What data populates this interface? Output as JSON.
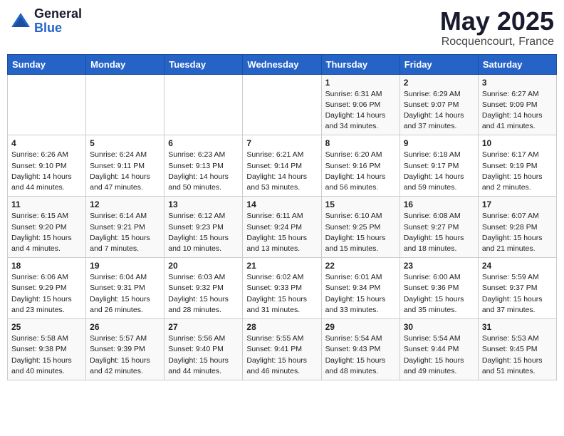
{
  "header": {
    "logo_general": "General",
    "logo_blue": "Blue",
    "month_title": "May 2025",
    "location": "Rocquencourt, France"
  },
  "weekdays": [
    "Sunday",
    "Monday",
    "Tuesday",
    "Wednesday",
    "Thursday",
    "Friday",
    "Saturday"
  ],
  "weeks": [
    [
      {
        "day": "",
        "info": ""
      },
      {
        "day": "",
        "info": ""
      },
      {
        "day": "",
        "info": ""
      },
      {
        "day": "",
        "info": ""
      },
      {
        "day": "1",
        "info": "Sunrise: 6:31 AM\nSunset: 9:06 PM\nDaylight: 14 hours\nand 34 minutes."
      },
      {
        "day": "2",
        "info": "Sunrise: 6:29 AM\nSunset: 9:07 PM\nDaylight: 14 hours\nand 37 minutes."
      },
      {
        "day": "3",
        "info": "Sunrise: 6:27 AM\nSunset: 9:09 PM\nDaylight: 14 hours\nand 41 minutes."
      }
    ],
    [
      {
        "day": "4",
        "info": "Sunrise: 6:26 AM\nSunset: 9:10 PM\nDaylight: 14 hours\nand 44 minutes."
      },
      {
        "day": "5",
        "info": "Sunrise: 6:24 AM\nSunset: 9:11 PM\nDaylight: 14 hours\nand 47 minutes."
      },
      {
        "day": "6",
        "info": "Sunrise: 6:23 AM\nSunset: 9:13 PM\nDaylight: 14 hours\nand 50 minutes."
      },
      {
        "day": "7",
        "info": "Sunrise: 6:21 AM\nSunset: 9:14 PM\nDaylight: 14 hours\nand 53 minutes."
      },
      {
        "day": "8",
        "info": "Sunrise: 6:20 AM\nSunset: 9:16 PM\nDaylight: 14 hours\nand 56 minutes."
      },
      {
        "day": "9",
        "info": "Sunrise: 6:18 AM\nSunset: 9:17 PM\nDaylight: 14 hours\nand 59 minutes."
      },
      {
        "day": "10",
        "info": "Sunrise: 6:17 AM\nSunset: 9:19 PM\nDaylight: 15 hours\nand 2 minutes."
      }
    ],
    [
      {
        "day": "11",
        "info": "Sunrise: 6:15 AM\nSunset: 9:20 PM\nDaylight: 15 hours\nand 4 minutes."
      },
      {
        "day": "12",
        "info": "Sunrise: 6:14 AM\nSunset: 9:21 PM\nDaylight: 15 hours\nand 7 minutes."
      },
      {
        "day": "13",
        "info": "Sunrise: 6:12 AM\nSunset: 9:23 PM\nDaylight: 15 hours\nand 10 minutes."
      },
      {
        "day": "14",
        "info": "Sunrise: 6:11 AM\nSunset: 9:24 PM\nDaylight: 15 hours\nand 13 minutes."
      },
      {
        "day": "15",
        "info": "Sunrise: 6:10 AM\nSunset: 9:25 PM\nDaylight: 15 hours\nand 15 minutes."
      },
      {
        "day": "16",
        "info": "Sunrise: 6:08 AM\nSunset: 9:27 PM\nDaylight: 15 hours\nand 18 minutes."
      },
      {
        "day": "17",
        "info": "Sunrise: 6:07 AM\nSunset: 9:28 PM\nDaylight: 15 hours\nand 21 minutes."
      }
    ],
    [
      {
        "day": "18",
        "info": "Sunrise: 6:06 AM\nSunset: 9:29 PM\nDaylight: 15 hours\nand 23 minutes."
      },
      {
        "day": "19",
        "info": "Sunrise: 6:04 AM\nSunset: 9:31 PM\nDaylight: 15 hours\nand 26 minutes."
      },
      {
        "day": "20",
        "info": "Sunrise: 6:03 AM\nSunset: 9:32 PM\nDaylight: 15 hours\nand 28 minutes."
      },
      {
        "day": "21",
        "info": "Sunrise: 6:02 AM\nSunset: 9:33 PM\nDaylight: 15 hours\nand 31 minutes."
      },
      {
        "day": "22",
        "info": "Sunrise: 6:01 AM\nSunset: 9:34 PM\nDaylight: 15 hours\nand 33 minutes."
      },
      {
        "day": "23",
        "info": "Sunrise: 6:00 AM\nSunset: 9:36 PM\nDaylight: 15 hours\nand 35 minutes."
      },
      {
        "day": "24",
        "info": "Sunrise: 5:59 AM\nSunset: 9:37 PM\nDaylight: 15 hours\nand 37 minutes."
      }
    ],
    [
      {
        "day": "25",
        "info": "Sunrise: 5:58 AM\nSunset: 9:38 PM\nDaylight: 15 hours\nand 40 minutes."
      },
      {
        "day": "26",
        "info": "Sunrise: 5:57 AM\nSunset: 9:39 PM\nDaylight: 15 hours\nand 42 minutes."
      },
      {
        "day": "27",
        "info": "Sunrise: 5:56 AM\nSunset: 9:40 PM\nDaylight: 15 hours\nand 44 minutes."
      },
      {
        "day": "28",
        "info": "Sunrise: 5:55 AM\nSunset: 9:41 PM\nDaylight: 15 hours\nand 46 minutes."
      },
      {
        "day": "29",
        "info": "Sunrise: 5:54 AM\nSunset: 9:43 PM\nDaylight: 15 hours\nand 48 minutes."
      },
      {
        "day": "30",
        "info": "Sunrise: 5:54 AM\nSunset: 9:44 PM\nDaylight: 15 hours\nand 49 minutes."
      },
      {
        "day": "31",
        "info": "Sunrise: 5:53 AM\nSunset: 9:45 PM\nDaylight: 15 hours\nand 51 minutes."
      }
    ]
  ]
}
